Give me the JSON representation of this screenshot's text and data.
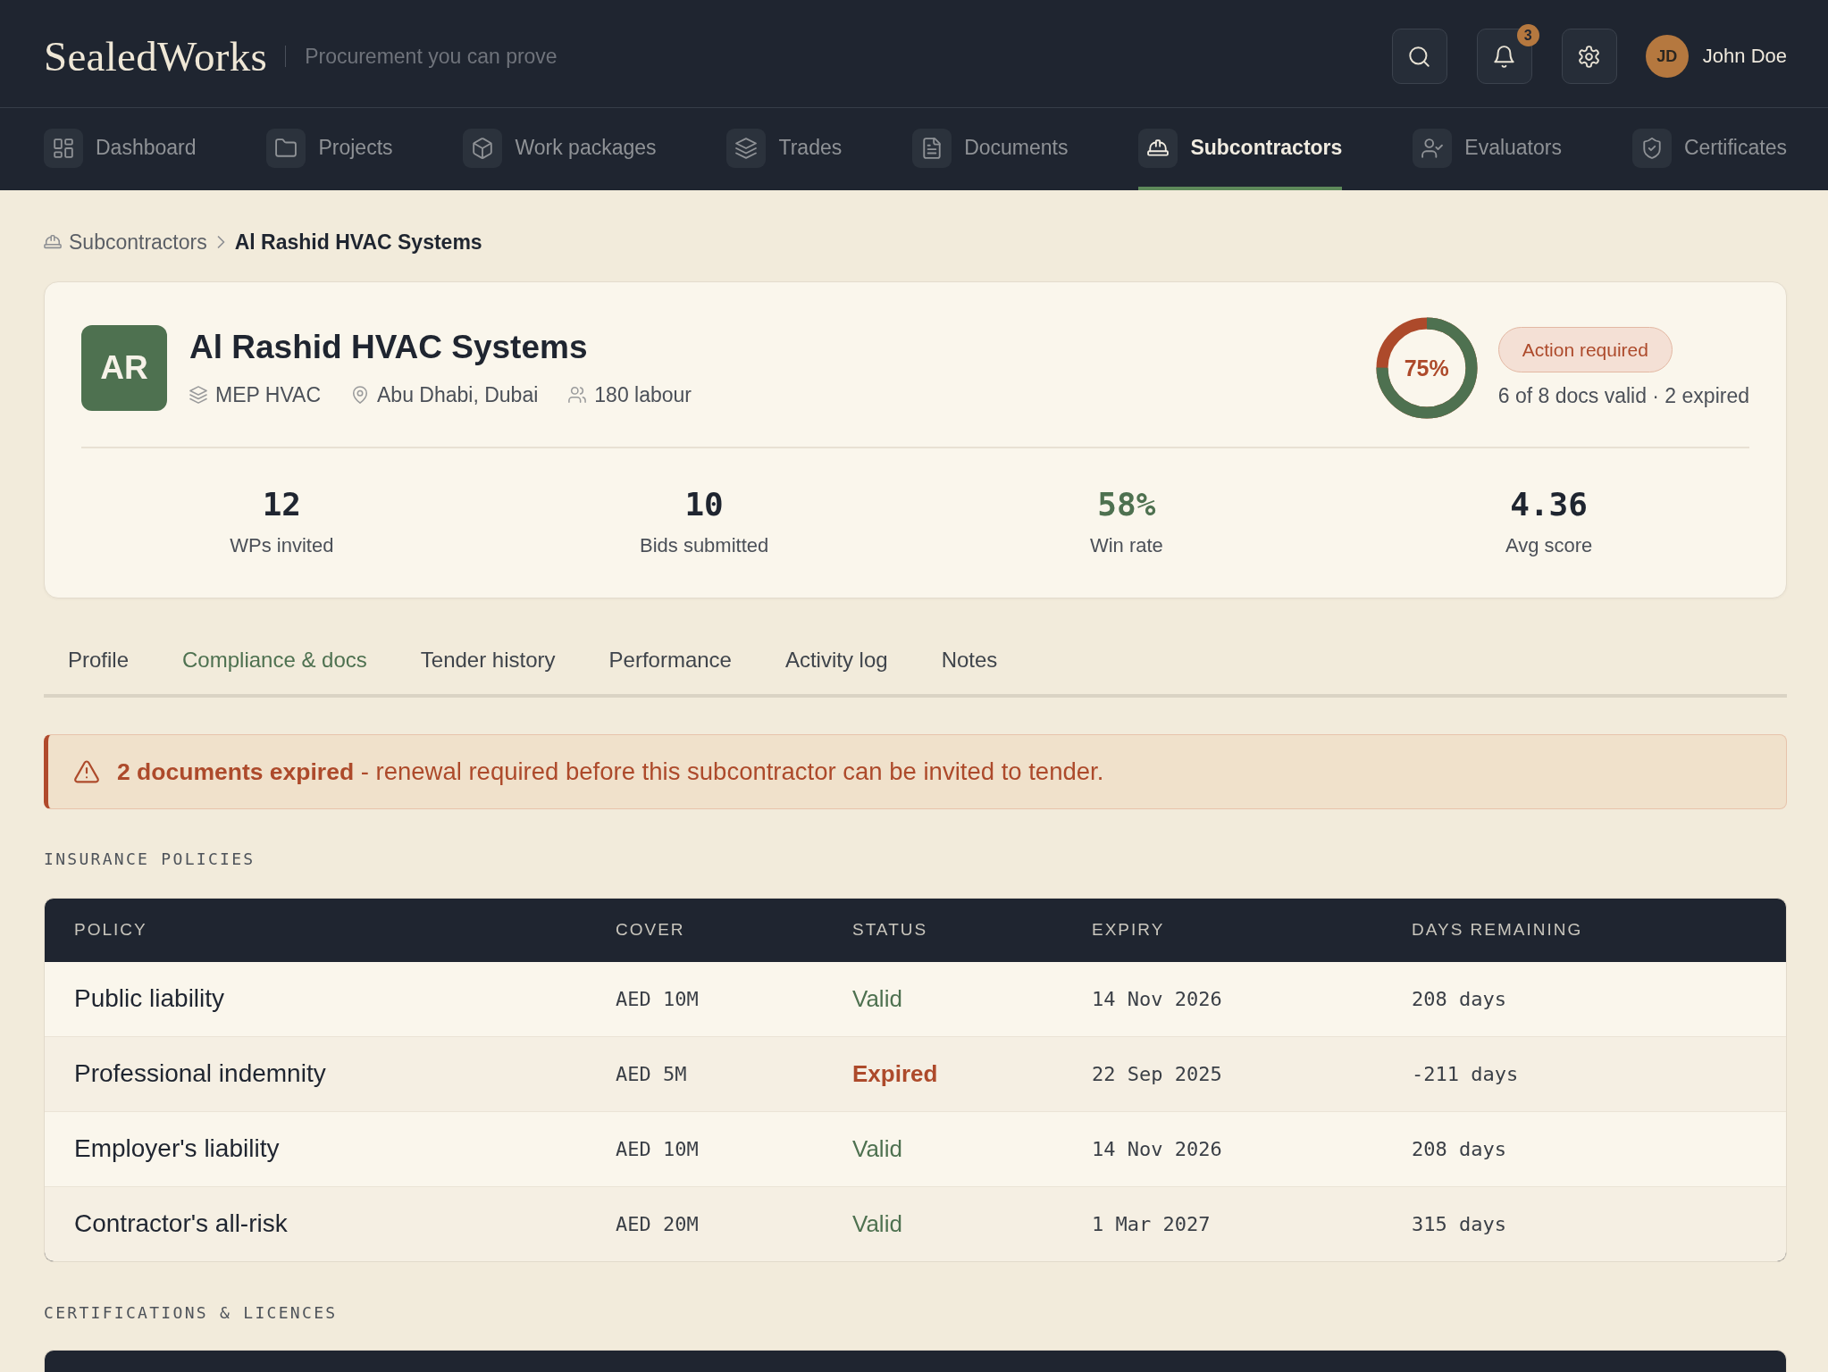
{
  "header": {
    "logo": "SealedWorks",
    "tagline": "Procurement you can prove",
    "notifications": "3",
    "user": {
      "initials": "JD",
      "name": "John Doe"
    }
  },
  "nav": [
    {
      "label": "Dashboard",
      "selected": false
    },
    {
      "label": "Projects",
      "selected": false
    },
    {
      "label": "Work packages",
      "selected": false
    },
    {
      "label": "Trades",
      "selected": false
    },
    {
      "label": "Documents",
      "selected": false
    },
    {
      "label": "Subcontractors",
      "selected": true
    },
    {
      "label": "Evaluators",
      "selected": false
    },
    {
      "label": "Certificates",
      "selected": false
    }
  ],
  "breadcrumb": [
    "Subcontractors",
    "Al Rashid HVAC Systems"
  ],
  "company": {
    "initials": "AR",
    "name": "Al Rashid HVAC Systems",
    "meta": [
      "MEP HVAC",
      "Abu Dhabi, Dubai",
      "180 labour"
    ],
    "compliance": {
      "level": 0.75,
      "percent": "75%",
      "status": "Action required",
      "summary": "6 of 8 docs valid · 2 expired"
    },
    "stats": [
      {
        "value": "12",
        "label": "WPs invited",
        "color": "#1f2530"
      },
      {
        "value": "10",
        "label": "Bids submitted",
        "color": "#1f2530"
      },
      {
        "value": "58%",
        "label": "Win rate",
        "color": "#4e7150"
      },
      {
        "value": "4.36",
        "label": "Avg score",
        "color": "#1f2530"
      }
    ]
  },
  "tabs": [
    {
      "label": "Profile",
      "selected": false
    },
    {
      "label": "Compliance & docs",
      "selected": true
    },
    {
      "label": "Tender history",
      "selected": false
    },
    {
      "label": "Performance",
      "selected": false
    },
    {
      "label": "Activity log",
      "selected": false
    },
    {
      "label": "Notes",
      "selected": false
    }
  ],
  "alert": {
    "message": "**2 documents expired** - renewal required before this subcontractor can be invited to tender."
  },
  "sections": [
    {
      "title": "INSURANCE POLICIES",
      "table": {
        "columns": [
          "POLICY",
          "COVER",
          "STATUS",
          "EXPIRY",
          "DAYS REMAINING"
        ],
        "rows": [
          {
            "policy": "Public liability",
            "cover": "AED 10M",
            "status": "Valid",
            "expired": false,
            "expiry": "14 Nov 2026",
            "days_remaining": "208 days"
          },
          {
            "policy": "Professional indemnity",
            "cover": "AED 5M",
            "status": "Expired",
            "expired": true,
            "expiry": "22 Sep 2025",
            "days_remaining": "-211 days"
          },
          {
            "policy": "Employer's liability",
            "cover": "AED 10M",
            "status": "Valid",
            "expired": false,
            "expiry": "14 Nov 2026",
            "days_remaining": "208 days"
          },
          {
            "policy": "Contractor's all-risk",
            "cover": "AED 20M",
            "status": "Valid",
            "expired": false,
            "expiry": "1 Mar 2027",
            "days_remaining": "315 days"
          }
        ]
      }
    },
    {
      "title": "CERTIFICATIONS & LICENCES"
    }
  ]
}
